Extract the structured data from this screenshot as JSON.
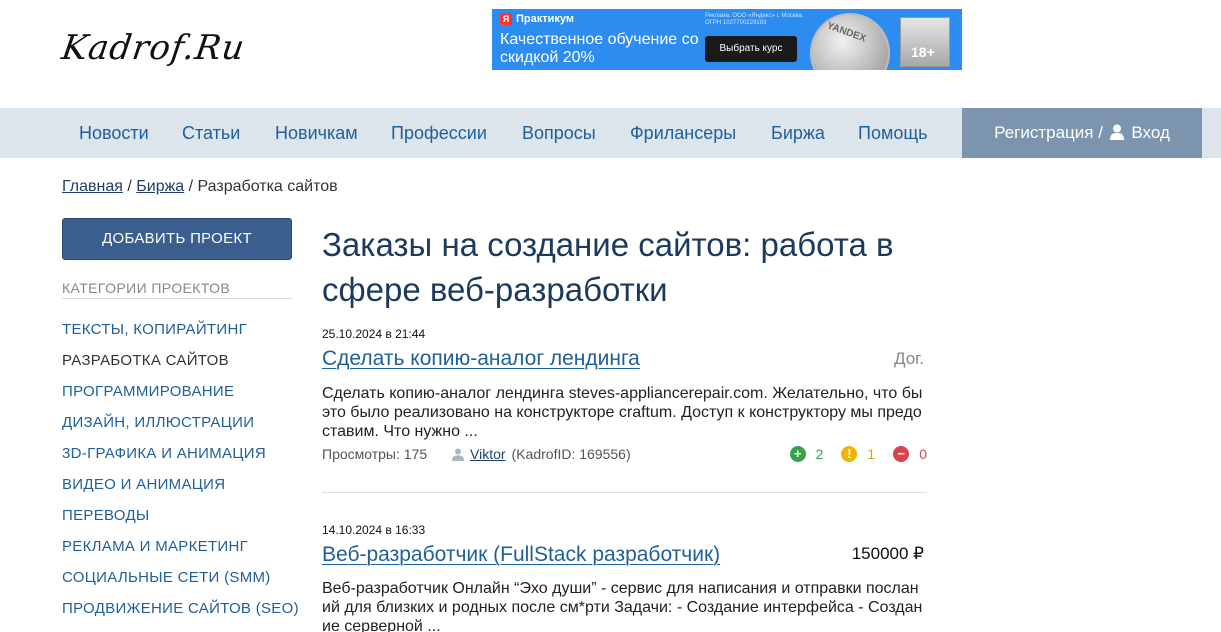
{
  "header": {
    "logo_text": "Kadrof.Ru",
    "ad": {
      "brand": "Практикум",
      "text": "Качественное обучение со скидкой 20%",
      "legal": "Реклама. ООО «Яндекс» г. Москва, ОГРН 1027700229193",
      "button": "Выбрать курс",
      "coin": "YANDEX",
      "age": "18+"
    }
  },
  "nav": {
    "items": [
      "Новости",
      "Статьи",
      "Новичкам",
      "Профессии",
      "Вопросы",
      "Фрилансеры",
      "Биржа",
      "Помощь"
    ],
    "register": "Регистрация /",
    "login": "Вход"
  },
  "breadcrumb": {
    "home": "Главная",
    "sep1": " / ",
    "exchange": "Биржа",
    "sep2": " / ",
    "current": "Разработка сайтов"
  },
  "sidebar": {
    "add_button": "ДОБАВИТЬ ПРОЕКТ",
    "categories_title": "КАТЕГОРИИ ПРОЕКТОВ",
    "categories": [
      "ТЕКСТЫ, КОПИРАЙТИНГ",
      "РАЗРАБОТКА САЙТОВ",
      "ПРОГРАММИРОВАНИЕ",
      "ДИЗАЙН, ИЛЛЮСТРАЦИИ",
      "3D-ГРАФИКА И АНИМАЦИЯ",
      "ВИДЕО И АНИМАЦИЯ",
      "ПЕРЕВОДЫ",
      "РЕКЛАМА И МАРКЕТИНГ",
      "СОЦИАЛЬНЫЕ СЕТИ (SMM)",
      "ПРОДВИЖЕНИЕ САЙТОВ (SEO)"
    ],
    "active_category": "РАЗРАБОТКА САЙТОВ"
  },
  "main": {
    "title": "Заказы на создание сайтов: работа в сфере веб-разработки",
    "orders": [
      {
        "date": "25.10.2024 в 21:44",
        "title": "Сделать копию-аналог лендинга",
        "price": "Дог.",
        "description": "Сделать копию-аналог лендинга steves-appliancerepair.com. Желательно, что бы это было реализовано на конструкторе craftum. Доступ к конструктору мы предо ставим. Что нужно ...",
        "views": "Просмотры: 175",
        "author": "Viktor",
        "author_id": "(KadrofID: 169556)",
        "votes_positive": "2",
        "votes_neutral": "1",
        "votes_negative": "0"
      },
      {
        "date": "14.10.2024 в 16:33",
        "title": "Веб-разработчик (FullStack разработчик)",
        "price": "150000 ₽",
        "description": "Веб-разработчик Онлайн “Эхо души” - сервис для написания и отправки послан ий для близких и родных после см*рти Задачи: - Создание интерфейса - Создан ие серверной ..."
      }
    ]
  },
  "colors": {
    "nav_bg": "#dce4ec",
    "auth_bg": "#7d94ae",
    "link": "#1f5f9a",
    "title": "#1c3a5e",
    "button": "#3a5f8f",
    "vote_positive": "#3aa14b",
    "vote_neutral": "#f0b400",
    "vote_negative": "#d9434b"
  }
}
